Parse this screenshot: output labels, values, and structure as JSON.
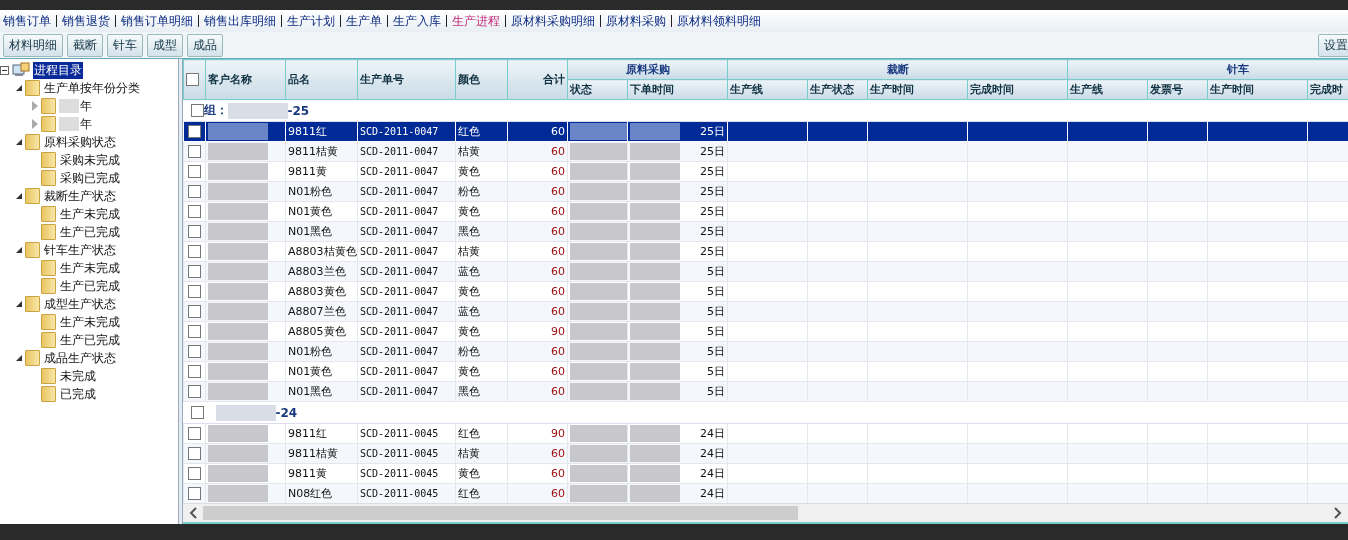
{
  "menu": [
    {
      "label": "销售订单",
      "selected": false
    },
    {
      "label": "销售退货",
      "selected": false
    },
    {
      "label": "销售订单明细",
      "selected": false
    },
    {
      "label": "销售出库明细",
      "selected": false
    },
    {
      "label": "生产计划",
      "selected": false
    },
    {
      "label": "生产单",
      "selected": false
    },
    {
      "label": "生产入库",
      "selected": false
    },
    {
      "label": "生产进程",
      "selected": true
    },
    {
      "label": "原材料采购明细",
      "selected": false
    },
    {
      "label": "原材料采购",
      "selected": false
    },
    {
      "label": "原材料领料明细",
      "selected": false
    }
  ],
  "toolbar": {
    "buttons": [
      "材料明细",
      "截断",
      "针车",
      "成型",
      "成品"
    ],
    "settings": "设置"
  },
  "tree": {
    "label": "进程目录",
    "selected": true,
    "children": [
      {
        "label": "生产单按年份分类",
        "expanded": true,
        "children": [
          {
            "label": "年",
            "expanded": false
          },
          {
            "label": "年",
            "expanded": false
          }
        ]
      },
      {
        "label": "原料采购状态",
        "expanded": true,
        "children": [
          {
            "label": "采购未完成"
          },
          {
            "label": "采购已完成"
          }
        ]
      },
      {
        "label": "裁断生产状态",
        "expanded": true,
        "children": [
          {
            "label": "生产未完成"
          },
          {
            "label": "生产已完成"
          }
        ]
      },
      {
        "label": "针车生产状态",
        "expanded": true,
        "children": [
          {
            "label": "生产未完成"
          },
          {
            "label": "生产已完成"
          }
        ]
      },
      {
        "label": "成型生产状态",
        "expanded": true,
        "children": [
          {
            "label": "生产未完成"
          },
          {
            "label": "生产已完成"
          }
        ]
      },
      {
        "label": "成品生产状态",
        "expanded": true,
        "children": [
          {
            "label": "未完成"
          },
          {
            "label": "已完成"
          }
        ]
      }
    ]
  },
  "grid": {
    "header_checked": false,
    "columns": [
      "客户名称",
      "品名",
      "生产单号",
      "颜色",
      "合计"
    ],
    "bands": [
      {
        "label": "原料采购",
        "columns": [
          "状态",
          "下单时间"
        ]
      },
      {
        "label": "裁断",
        "columns": [
          "生产线",
          "生产状态",
          "生产时间",
          "完成时间"
        ]
      },
      {
        "label": "针车",
        "columns": [
          "生产线",
          "发票号",
          "生产时间",
          "完成时"
        ]
      }
    ],
    "groups": [
      {
        "label_start": "组：",
        "label_end": "-25",
        "checked": false,
        "rows": [
          {
            "product": "9811红",
            "order_no": "SCD-2011-0047",
            "color_name": "红色",
            "total": "60",
            "date_tail": "25日",
            "selected": true,
            "checked": false
          },
          {
            "product": "9811桔黄",
            "order_no": "SCD-2011-0047",
            "color_name": "桔黄",
            "total": "60",
            "date_tail": "25日",
            "selected": false,
            "checked": false
          },
          {
            "product": "9811黄",
            "order_no": "SCD-2011-0047",
            "color_name": "黄色",
            "total": "60",
            "date_tail": "25日",
            "selected": false,
            "checked": false
          },
          {
            "product": "N01粉色",
            "order_no": "SCD-2011-0047",
            "color_name": "粉色",
            "total": "60",
            "date_tail": "25日",
            "selected": false,
            "checked": false
          },
          {
            "product": "N01黄色",
            "order_no": "SCD-2011-0047",
            "color_name": "黄色",
            "total": "60",
            "date_tail": "25日",
            "selected": false,
            "checked": false
          },
          {
            "product": "N01黑色",
            "order_no": "SCD-2011-0047",
            "color_name": "黑色",
            "total": "60",
            "date_tail": "25日",
            "selected": false,
            "checked": false
          },
          {
            "product": "A8803桔黄色",
            "order_no": "SCD-2011-0047",
            "color_name": "桔黄",
            "total": "60",
            "date_tail": "25日",
            "selected": false,
            "checked": false
          },
          {
            "product": "A8803兰色",
            "order_no": "SCD-2011-0047",
            "color_name": "蓝色",
            "total": "60",
            "date_tail": "5日",
            "selected": false,
            "checked": false
          },
          {
            "product": "A8803黄色",
            "order_no": "SCD-2011-0047",
            "color_name": "黄色",
            "total": "60",
            "date_tail": "5日",
            "selected": false,
            "checked": false
          },
          {
            "product": "A8807兰色",
            "order_no": "SCD-2011-0047",
            "color_name": "蓝色",
            "total": "60",
            "date_tail": "5日",
            "selected": false,
            "checked": false
          },
          {
            "product": "A8805黄色",
            "order_no": "SCD-2011-0047",
            "color_name": "黄色",
            "total": "90",
            "date_tail": "5日",
            "selected": false,
            "checked": false
          },
          {
            "product": "N01粉色",
            "order_no": "SCD-2011-0047",
            "color_name": "粉色",
            "total": "60",
            "date_tail": "5日",
            "selected": false,
            "checked": false
          },
          {
            "product": "N01黄色",
            "order_no": "SCD-2011-0047",
            "color_name": "黄色",
            "total": "60",
            "date_tail": "5日",
            "selected": false,
            "checked": false
          },
          {
            "product": "N01黑色",
            "order_no": "SCD-2011-0047",
            "color_name": "黑色",
            "total": "60",
            "date_tail": "5日",
            "selected": false,
            "checked": false
          }
        ]
      },
      {
        "label_end": "-24",
        "checked": false,
        "rows": [
          {
            "product": "9811红",
            "order_no": "SCD-2011-0045",
            "color_name": "红色",
            "total": "90",
            "date_tail": "24日",
            "selected": false,
            "checked": false
          },
          {
            "product": "9811桔黄",
            "order_no": "SCD-2011-0045",
            "color_name": "桔黄",
            "total": "60",
            "date_tail": "24日",
            "selected": false,
            "checked": false
          },
          {
            "product": "9811黄",
            "order_no": "SCD-2011-0045",
            "color_name": "黄色",
            "total": "60",
            "date_tail": "24日",
            "selected": false,
            "checked": false
          },
          {
            "product": "N08红色",
            "order_no": "SCD-2011-0045",
            "color_name": "红色",
            "total": "60",
            "date_tail": "24日",
            "selected": false,
            "checked": false
          }
        ]
      }
    ]
  }
}
